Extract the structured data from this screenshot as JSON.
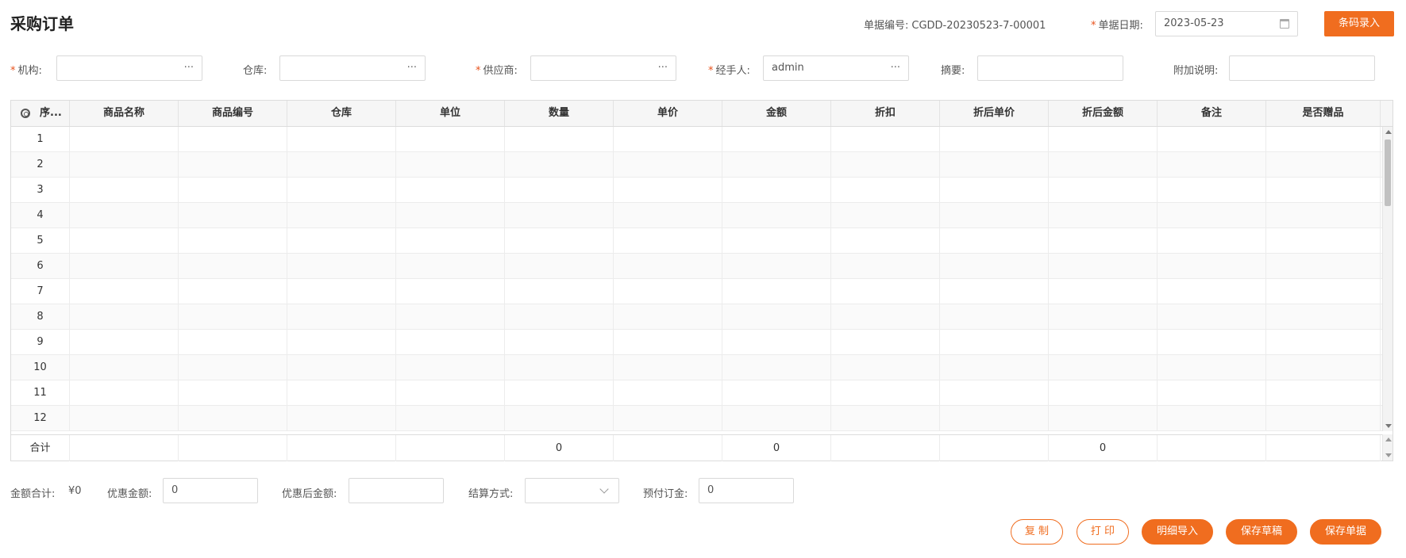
{
  "header": {
    "title": "采购订单",
    "doc_no_label": "单据编号:",
    "doc_no_value": "CGDD-20230523-7-00001",
    "doc_date_label": "单据日期:",
    "doc_date_value": "2023-05-23",
    "barcode_button": "条码录入"
  },
  "form": {
    "org_label": "机构:",
    "org_value": "",
    "warehouse_label": "仓库:",
    "warehouse_value": "",
    "supplier_label": "供应商:",
    "supplier_value": "",
    "handler_label": "经手人:",
    "handler_value": "admin",
    "summary_label": "摘要:",
    "summary_value": "",
    "extra_label": "附加说明:",
    "extra_value": "",
    "ellipsis": "···",
    "required_mark": "*"
  },
  "grid": {
    "columns": [
      "序...",
      "商品名称",
      "商品编号",
      "仓库",
      "单位",
      "数量",
      "单价",
      "金额",
      "折扣",
      "折后单价",
      "折后金额",
      "备注",
      "是否赠品"
    ],
    "rows": [
      "1",
      "2",
      "3",
      "4",
      "5",
      "6",
      "7",
      "8",
      "9",
      "10",
      "11",
      "12"
    ],
    "footer": {
      "label": "合计",
      "qty_total": "0",
      "amount_total": "0",
      "disc_amount_total": "0"
    }
  },
  "summary": {
    "total_label": "金额合计:",
    "total_value": "¥0",
    "discount_label": "优惠金额:",
    "discount_value": "0",
    "after_discount_label": "优惠后金额:",
    "after_discount_value": "",
    "settle_label": "结算方式:",
    "settle_value": "",
    "deposit_label": "预付订金:",
    "deposit_value": "0"
  },
  "actions": {
    "copy": "复 制",
    "print": "打 印",
    "import_detail": "明细导入",
    "save_draft": "保存草稿",
    "save_doc": "保存单据"
  },
  "colors": {
    "accent": "#f06d1f",
    "required": "#e8521c"
  }
}
